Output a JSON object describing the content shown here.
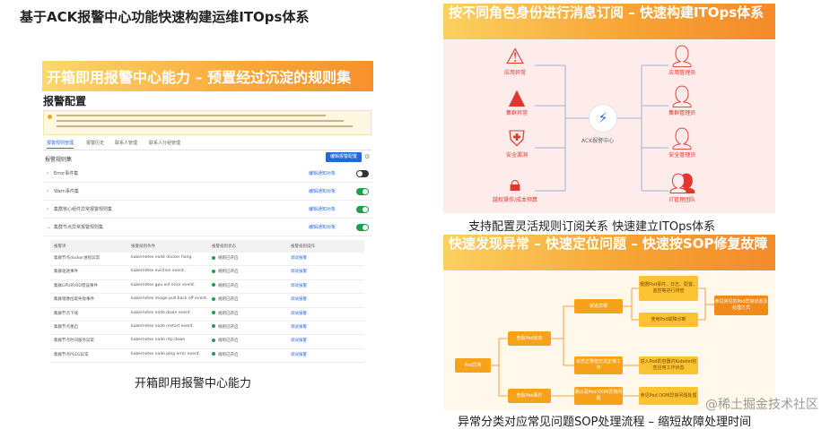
{
  "page_title": "基于ACK报警中心功能快速构建运维ITOps体系",
  "left_panel": {
    "banner": "开箱即用报警中心能力 – 预置经过沉淀的规则集",
    "subtitle": "报警配置",
    "tabs": [
      "报警规则管理",
      "报警历史",
      "联系人管理",
      "联系人分组管理"
    ],
    "list_label": "报警规则集",
    "primary_button": "编辑报警配置",
    "groups": [
      {
        "label": "Error事件集",
        "action": "编辑通知对象",
        "enabled": false
      },
      {
        "label": "Warn事件集",
        "action": "编辑通知对象",
        "enabled": true
      },
      {
        "label": "集群核心组件异常报警规则集",
        "action": "编辑通知对象",
        "enabled": true
      },
      {
        "label": "集群节点异常报警规则集",
        "action": "编辑通知对象",
        "enabled": true
      }
    ],
    "table_headers": [
      "报警项",
      "报警规则条件",
      "报警规则状态",
      "报警规则操作"
    ],
    "table_rows": [
      {
        "item": "集群节点docker进程异常",
        "cond": "kubernetes node docker hang.",
        "status": "规则已开启",
        "op": "调试报警"
      },
      {
        "item": "集群驱逐事件",
        "cond": "kubernetes eviction event.",
        "status": "规则已开启",
        "op": "调试报警"
      },
      {
        "item": "集群GPU的XID错误事件",
        "cond": "kubernetes gpu xid error event.",
        "status": "规则已开启",
        "op": "调试报警"
      },
      {
        "item": "集群镜像拉取失败事件",
        "cond": "kubernetes image pull back off event.",
        "status": "规则已开启",
        "op": "调试报警"
      },
      {
        "item": "集群节点下线",
        "cond": "kubernetes node down event.",
        "status": "规则已开启",
        "op": "调试报警"
      },
      {
        "item": "集群节点重启",
        "cond": "kubernetes node restart event.",
        "status": "规则已开启",
        "op": "调试报警"
      },
      {
        "item": "集群节点时间服务异常",
        "cond": "kubernetes node ntp down",
        "status": "规则已开启",
        "op": "调试报警"
      },
      {
        "item": "集群节点PLEG异常",
        "cond": "kubernetes node pleg error event.",
        "status": "规则已开启",
        "op": "调试报警"
      }
    ],
    "caption": "开箱即用报警中心能力"
  },
  "right_top": {
    "banner": "按不同角色身份进行消息订阅 – 快速构建ITOps体系",
    "left_roles": [
      "应用异常",
      "集群异常",
      "安全漏洞",
      "越权操作/成本预算"
    ],
    "right_roles": [
      "应用管理员",
      "集群管理员",
      "安全管理员",
      "IT管理团队"
    ],
    "hub_label": "ACK报警中心",
    "caption": "支持配置灵活规则订阅关系 快速建立ITOps体系",
    "accent_color": "#e2362f"
  },
  "right_bottom": {
    "banner": "快速发现异常 – 快速定位问题 – 快速按SOP修复故障",
    "flow": {
      "root": "Pod异常",
      "mid": [
        "查看Pod状态",
        "查看Pod事件"
      ],
      "leaf_a": "状态异常",
      "leaf_b": "状态正常但无法正常工作",
      "leaf_c": "确认是Pod OOM异常问题",
      "detail_1": "根据Pod事件、日志、配置、监控等进行排查",
      "detail_2": "使用Pod故障诊断",
      "detail_3": "进入Pod的容器内Kubelet检查应用工作状态",
      "detail_4": "参见Pod OOM异常问题处理",
      "fix_1": "参见常见的Pod异常状态及处理方式"
    },
    "caption": "异常分类对应常见问题SOP处理流程 – 缩短故障处理时间",
    "accent_color": "#f7a21b"
  },
  "watermark": "@稀土掘金技术社区"
}
